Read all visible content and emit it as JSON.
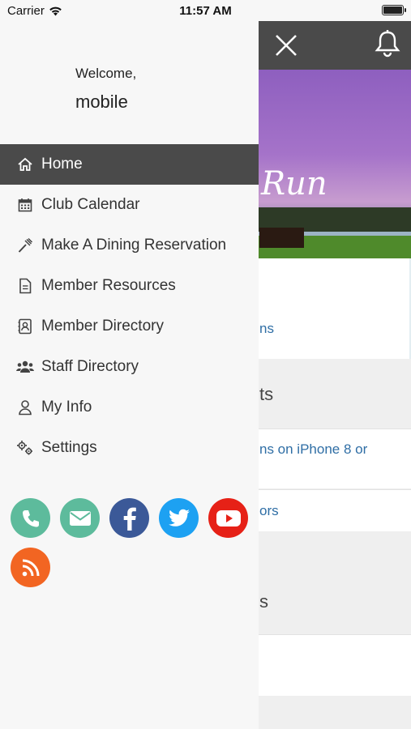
{
  "status_bar": {
    "carrier": "Carrier",
    "time": "11:57 AM"
  },
  "drawer": {
    "welcome": "Welcome,",
    "username": "mobile",
    "menu": [
      {
        "label": "Home",
        "icon": "home-icon",
        "active": true
      },
      {
        "label": "Club Calendar",
        "icon": "calendar-icon"
      },
      {
        "label": "Make A Dining Reservation",
        "icon": "utensils-icon"
      },
      {
        "label": "Member Resources",
        "icon": "document-icon"
      },
      {
        "label": "Member Directory",
        "icon": "contact-book-icon"
      },
      {
        "label": "Staff Directory",
        "icon": "group-icon"
      },
      {
        "label": "My Info",
        "icon": "user-icon"
      },
      {
        "label": "Settings",
        "icon": "gears-icon"
      }
    ],
    "social": [
      {
        "name": "phone-icon",
        "color": "#5dbb9c"
      },
      {
        "name": "email-icon",
        "color": "#5dbb9c"
      },
      {
        "name": "facebook-icon",
        "color": "#3b5998"
      },
      {
        "name": "twitter-icon",
        "color": "#1da1f2"
      },
      {
        "name": "youtube-icon",
        "color": "#e62117"
      },
      {
        "name": "rss-icon",
        "color": "#f26522"
      }
    ]
  },
  "background": {
    "hero_text": "Run",
    "link_1": "ns",
    "section_1": "ts",
    "link_2": "ns on iPhone 8 or",
    "link_3": "ors",
    "section_2": "s"
  }
}
